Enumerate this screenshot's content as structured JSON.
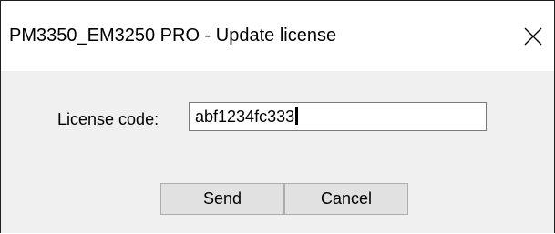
{
  "window": {
    "title": "PM3350_EM3250 PRO - Update license",
    "close_icon": "close-icon"
  },
  "form": {
    "license_label": "License code:",
    "license_value": "abf1234fc333"
  },
  "buttons": {
    "send_label": "Send",
    "cancel_label": "Cancel"
  },
  "colors": {
    "titlebar_background": "#ffffff",
    "dialog_background": "#f0f0f0",
    "button_face": "#e1e1e1",
    "button_border": "#adadad",
    "input_border": "#7a7a7a"
  }
}
